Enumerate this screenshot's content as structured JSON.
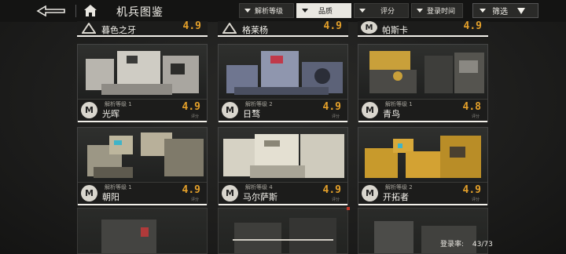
{
  "header": {
    "title": "机兵图鉴",
    "filters": [
      {
        "label": "解析等级",
        "active": false
      },
      {
        "label": "品质",
        "active": true
      },
      {
        "label": "评分",
        "active": false
      },
      {
        "label": "登录时间",
        "active": false
      }
    ],
    "filter_button": "筛选"
  },
  "top_row": [
    {
      "name": "暮色之牙",
      "score": "4.9"
    },
    {
      "name": "格莱杨",
      "score": "4.9"
    },
    {
      "name": "帕斯卡",
      "score": "4.9"
    }
  ],
  "cards": [
    {
      "name": "光晖",
      "level": "解析等级 1",
      "score": "4.9",
      "score_label": "评分",
      "logo": "M"
    },
    {
      "name": "日骛",
      "level": "解析等级 2",
      "score": "4.9",
      "score_label": "评分",
      "logo": "M"
    },
    {
      "name": "青鸟",
      "level": "解析等级 1",
      "score": "4.8",
      "score_label": "评分",
      "logo": "M"
    },
    {
      "name": "朝阳",
      "level": "解析等级 1",
      "score": "4.9",
      "score_label": "评分",
      "logo": "M"
    },
    {
      "name": "马尔萨斯",
      "level": "解析等级 4",
      "score": "4.9",
      "score_label": "评分",
      "logo": "M"
    },
    {
      "name": "开拓者",
      "level": "解析等级 2",
      "score": "4.9",
      "score_label": "评分",
      "logo": "M"
    }
  ],
  "footer": {
    "label": "登录率:",
    "value": "43/73"
  },
  "colors": {
    "accent": "#e4a02a",
    "bg": "#1b1b1a",
    "panel": "#cfcbc2"
  }
}
